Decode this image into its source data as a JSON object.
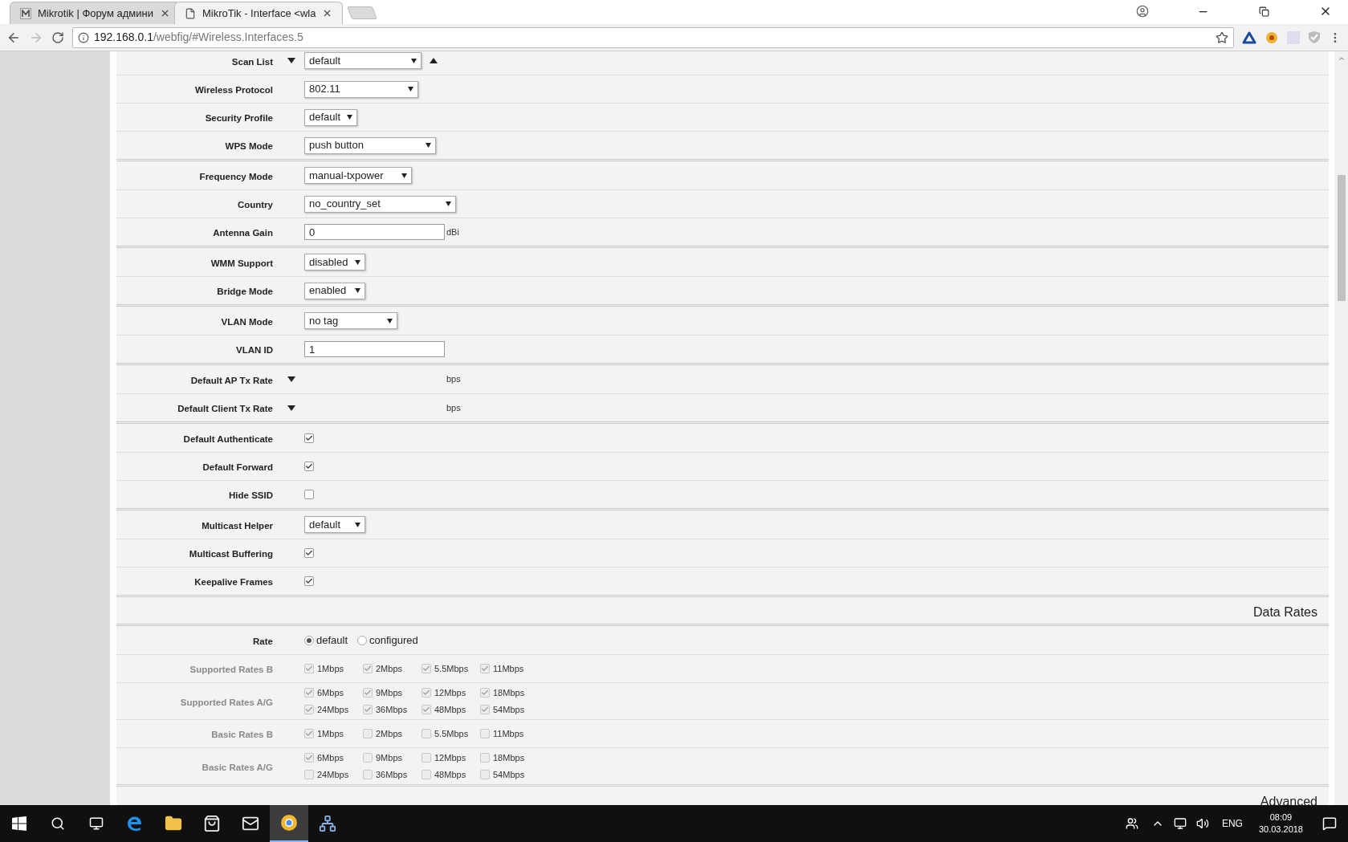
{
  "browser": {
    "tabs": [
      {
        "title": "Mikrotik | Форум админи",
        "kind": "forum",
        "selected": false
      },
      {
        "title": "MikroTik - Interface <wla",
        "kind": "page",
        "selected": true
      }
    ],
    "url": {
      "host": "192.168.0.1",
      "path": "/webfig/#Wireless.Interfaces.5"
    }
  },
  "groups": [
    {
      "kind": "fields",
      "rows": [
        {
          "kind": "select_list",
          "label": "Scan List",
          "value": "default"
        },
        {
          "kind": "select",
          "label": "Wireless Protocol",
          "value": "802.11"
        },
        {
          "kind": "select",
          "label": "Security Profile",
          "value": "default"
        },
        {
          "kind": "select",
          "label": "WPS Mode",
          "value": "push button"
        }
      ]
    },
    {
      "kind": "fields",
      "rows": [
        {
          "kind": "select",
          "label": "Frequency Mode",
          "value": "manual-txpower"
        },
        {
          "kind": "select",
          "label": "Country",
          "value": "no_country_set"
        },
        {
          "kind": "input",
          "label": "Antenna Gain",
          "value": "0",
          "unit": "dBi"
        }
      ]
    },
    {
      "kind": "fields",
      "rows": [
        {
          "kind": "select",
          "label": "WMM Support",
          "value": "disabled"
        },
        {
          "kind": "select",
          "label": "Bridge Mode",
          "value": "enabled"
        }
      ]
    },
    {
      "kind": "fields",
      "rows": [
        {
          "kind": "select",
          "label": "VLAN Mode",
          "value": "no tag"
        },
        {
          "kind": "input",
          "label": "VLAN ID",
          "value": "1"
        }
      ]
    },
    {
      "kind": "fields",
      "rows": [
        {
          "kind": "rate",
          "label": "Default AP Tx Rate",
          "unit": "bps"
        },
        {
          "kind": "rate",
          "label": "Default Client Tx Rate",
          "unit": "bps"
        }
      ]
    },
    {
      "kind": "fields",
      "rows": [
        {
          "kind": "checkbox",
          "label": "Default Authenticate",
          "checked": true
        },
        {
          "kind": "checkbox",
          "label": "Default Forward",
          "checked": true
        },
        {
          "kind": "checkbox",
          "label": "Hide SSID",
          "checked": false
        }
      ]
    },
    {
      "kind": "fields",
      "rows": [
        {
          "kind": "select",
          "label": "Multicast Helper",
          "value": "default"
        },
        {
          "kind": "checkbox",
          "label": "Multicast Buffering",
          "checked": true
        },
        {
          "kind": "checkbox",
          "label": "Keepalive Frames",
          "checked": true
        }
      ]
    },
    {
      "kind": "heading",
      "title": "Data Rates"
    },
    {
      "kind": "fields",
      "rows": [
        {
          "kind": "radio",
          "label": "Rate",
          "options": [
            {
              "label": "default",
              "selected": true
            },
            {
              "label": "configured",
              "selected": false
            }
          ]
        },
        {
          "kind": "checkgroup",
          "label": "Supported Rates B",
          "disabled": true,
          "options": [
            {
              "label": "1Mbps",
              "checked": true
            },
            {
              "label": "2Mbps",
              "checked": true
            },
            {
              "label": "5.5Mbps",
              "checked": true
            },
            {
              "label": "11Mbps",
              "checked": true
            }
          ]
        },
        {
          "kind": "checkgroup",
          "label": "Supported Rates A/G",
          "disabled": true,
          "options": [
            {
              "label": "6Mbps",
              "checked": true
            },
            {
              "label": "9Mbps",
              "checked": true
            },
            {
              "label": "12Mbps",
              "checked": true
            },
            {
              "label": "18Mbps",
              "checked": true
            },
            {
              "label": "24Mbps",
              "checked": true
            },
            {
              "label": "36Mbps",
              "checked": true
            },
            {
              "label": "48Mbps",
              "checked": true
            },
            {
              "label": "54Mbps",
              "checked": true
            }
          ]
        },
        {
          "kind": "checkgroup",
          "label": "Basic Rates B",
          "disabled": true,
          "options": [
            {
              "label": "1Mbps",
              "checked": true
            },
            {
              "label": "2Mbps",
              "checked": false
            },
            {
              "label": "5.5Mbps",
              "checked": false
            },
            {
              "label": "11Mbps",
              "checked": false
            }
          ]
        },
        {
          "kind": "checkgroup",
          "label": "Basic Rates A/G",
          "disabled": true,
          "options": [
            {
              "label": "6Mbps",
              "checked": true
            },
            {
              "label": "9Mbps",
              "checked": false
            },
            {
              "label": "12Mbps",
              "checked": false
            },
            {
              "label": "18Mbps",
              "checked": false
            },
            {
              "label": "24Mbps",
              "checked": false
            },
            {
              "label": "36Mbps",
              "checked": false
            },
            {
              "label": "48Mbps",
              "checked": false
            },
            {
              "label": "54Mbps",
              "checked": false
            }
          ]
        }
      ]
    },
    {
      "kind": "heading",
      "title": "Advanced"
    }
  ],
  "taskbar": {
    "apps": [
      {
        "kind": "edge",
        "selected": false
      },
      {
        "kind": "explorer",
        "selected": false
      },
      {
        "kind": "store",
        "selected": false
      },
      {
        "kind": "mail",
        "selected": false
      },
      {
        "kind": "chrome",
        "selected": true
      },
      {
        "kind": "network",
        "selected": false
      }
    ],
    "language": "ENG",
    "time": "08:09",
    "date": "30.03.2018"
  }
}
